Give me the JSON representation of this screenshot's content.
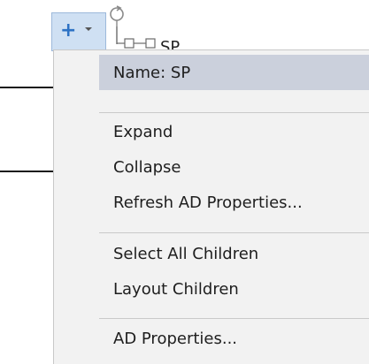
{
  "toolbar": {
    "add_icon": "plus-icon",
    "dropdown_icon": "chevron-down-icon",
    "refresh_icon": "refresh-icon",
    "accent_color": "#2d72c4"
  },
  "node": {
    "label": "SP"
  },
  "context_menu": {
    "header": "Name: SP",
    "groups": [
      {
        "items": [
          {
            "label": "Expand"
          },
          {
            "label": "Collapse"
          },
          {
            "label": "Refresh AD Properties..."
          }
        ]
      },
      {
        "items": [
          {
            "label": "Select All Children"
          },
          {
            "label": "Layout Children"
          }
        ]
      },
      {
        "items": [
          {
            "label": "AD Properties..."
          }
        ]
      }
    ],
    "header_color": "#cbd0dc",
    "background_color": "#f2f2f2"
  }
}
